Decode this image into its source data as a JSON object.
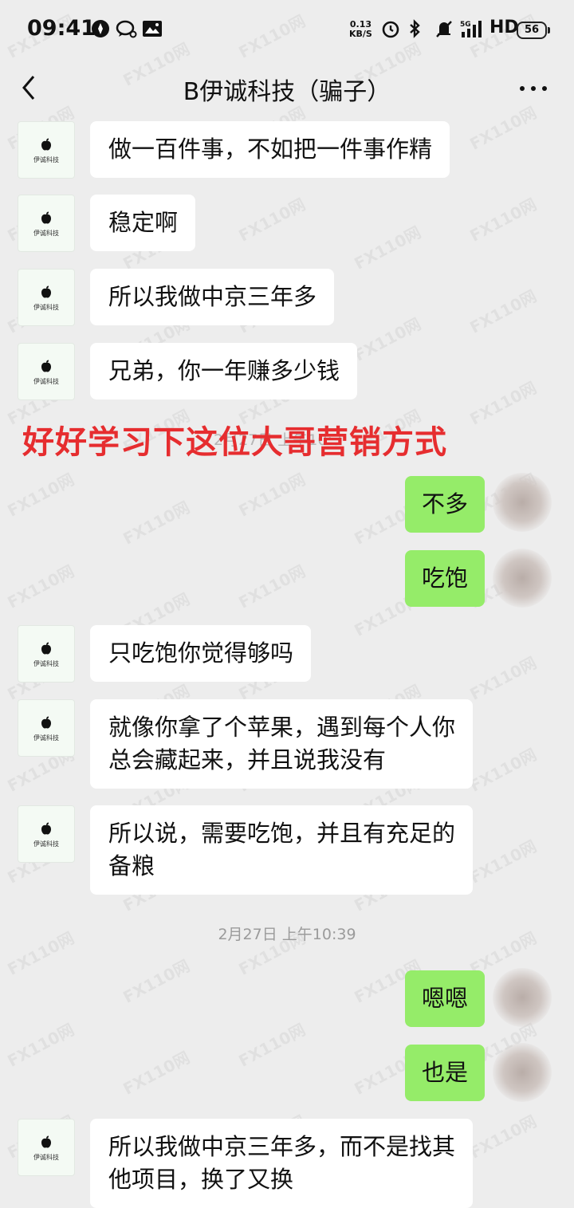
{
  "status_bar": {
    "time": "09:41",
    "net_speed_value": "0.13",
    "net_speed_unit": "KB/S",
    "network_type": "HD",
    "signal_label": "5G",
    "battery": "56"
  },
  "nav": {
    "title": "B伊诚科技（骗子）"
  },
  "avatar_label": "伊诚科技",
  "overlay_text": "好好学习下这位大哥营销方式",
  "faded_timestamp": "2月27日 上午10:3",
  "timestamp": "2月27日 上午10:39",
  "messages": [
    {
      "from": "other",
      "text": "做一百件事，不如把一件事作精"
    },
    {
      "from": "other",
      "text": "稳定啊"
    },
    {
      "from": "other",
      "text": "所以我做中京三年多"
    },
    {
      "from": "other",
      "text": "兄弟，你一年赚多少钱"
    },
    {
      "from": "me",
      "text": "不多"
    },
    {
      "from": "me",
      "text": "吃饱"
    },
    {
      "from": "other",
      "text": "只吃饱你觉得够吗"
    },
    {
      "from": "other",
      "text": "就像你拿了个苹果，遇到每个人你\n总会藏起来，并且说我没有"
    },
    {
      "from": "other",
      "text": "所以说，需要吃饱，并且有充足的\n备粮"
    },
    {
      "from": "me",
      "text": "嗯嗯"
    },
    {
      "from": "me",
      "text": "也是"
    },
    {
      "from": "other",
      "text": "所以我做中京三年多，而不是找其\n他项目，换了又换"
    }
  ],
  "watermark_text": "FX110网",
  "colors": {
    "background": "#ededed",
    "my_bubble": "#95ec69",
    "other_bubble": "#ffffff",
    "overlay_text": "#e62d2f"
  }
}
